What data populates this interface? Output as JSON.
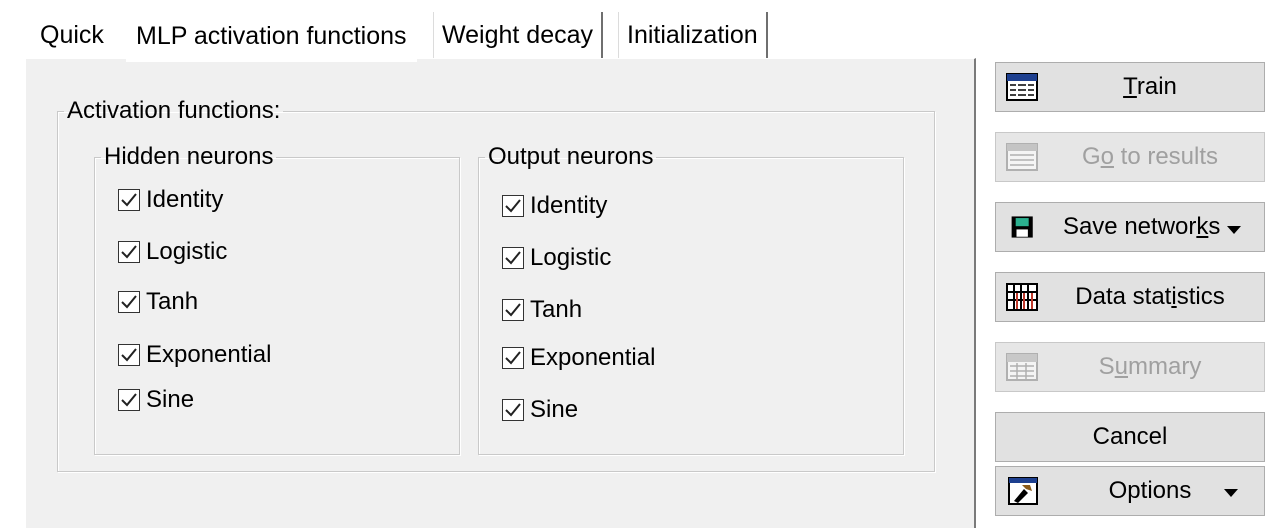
{
  "tabs": [
    {
      "label": "Quick"
    },
    {
      "label": "MLP activation functions"
    },
    {
      "label": "Weight decay"
    },
    {
      "label": "Initialization"
    }
  ],
  "activation_group_label": "Activation functions:",
  "hidden": {
    "label": "Hidden neurons",
    "items": [
      {
        "label": "Identity",
        "checked": true
      },
      {
        "label": "Logistic",
        "checked": true
      },
      {
        "label": "Tanh",
        "checked": true
      },
      {
        "label": "Exponential",
        "checked": true
      },
      {
        "label": "Sine",
        "checked": true
      }
    ]
  },
  "output": {
    "label": "Output neurons",
    "items": [
      {
        "label": "Identity",
        "checked": true
      },
      {
        "label": "Logistic",
        "checked": true
      },
      {
        "label": "Tanh",
        "checked": true
      },
      {
        "label": "Exponential",
        "checked": true
      },
      {
        "label": "Sine",
        "checked": true
      }
    ]
  },
  "buttons": {
    "train": {
      "pre": "",
      "u": "T",
      "post": "rain",
      "icon": "spreadsheet-icon",
      "enabled": true
    },
    "results": {
      "pre": "G",
      "u": "o",
      "post": " to results",
      "icon": "spreadsheet-icon",
      "enabled": false
    },
    "save": {
      "pre": "Save networ",
      "u": "k",
      "post": "s",
      "icon": "floppy-disk-icon",
      "enabled": true
    },
    "stats": {
      "pre": "Data stat",
      "u": "i",
      "post": "stics",
      "icon": "grid-icon",
      "enabled": true
    },
    "summary": {
      "pre": "S",
      "u": "u",
      "post": "mmary",
      "icon": "summary-table-icon",
      "enabled": false
    },
    "cancel": {
      "label": "Cancel",
      "enabled": true
    },
    "options": {
      "label": "Options",
      "icon": "options-icon",
      "enabled": true
    }
  }
}
